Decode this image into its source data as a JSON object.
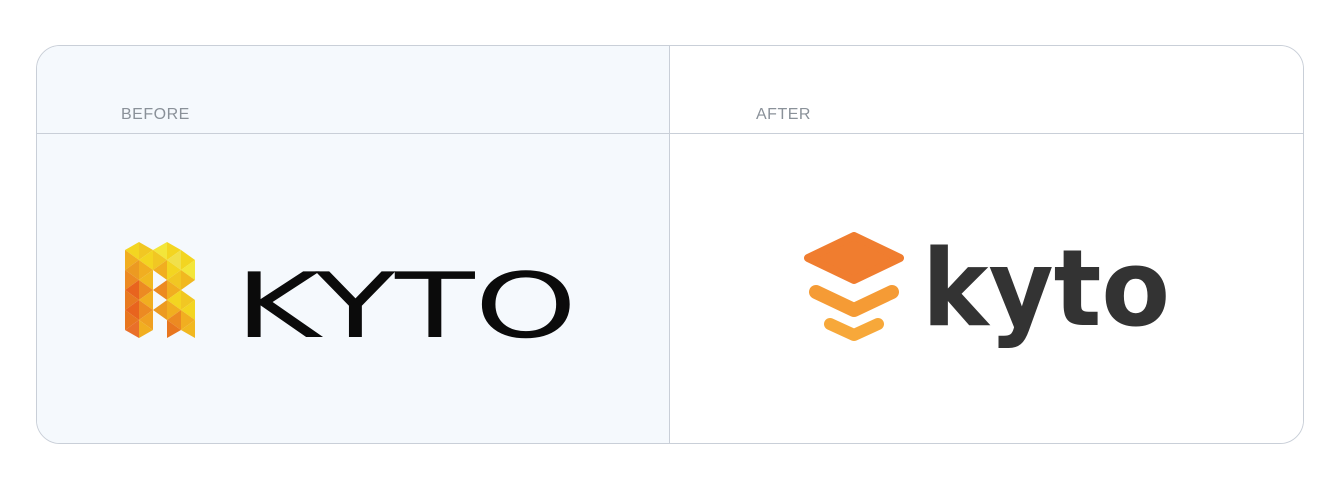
{
  "panels": {
    "before": {
      "label": "BEFORE",
      "logo_text": "KYTO",
      "logo_colors": [
        "#f3d521",
        "#f1ae20",
        "#ec8a22",
        "#e8641e"
      ],
      "wordmark_color": "#0b0b0b"
    },
    "after": {
      "label": "AFTER",
      "logo_text": "kyto",
      "logo_colors": [
        "#f07d2f",
        "#f59b35",
        "#f7a83a"
      ],
      "wordmark_color": "#333333"
    }
  },
  "colors": {
    "border": "#c9cfd8",
    "before_background": "#f5f9fd",
    "label_text": "#8a9199"
  }
}
